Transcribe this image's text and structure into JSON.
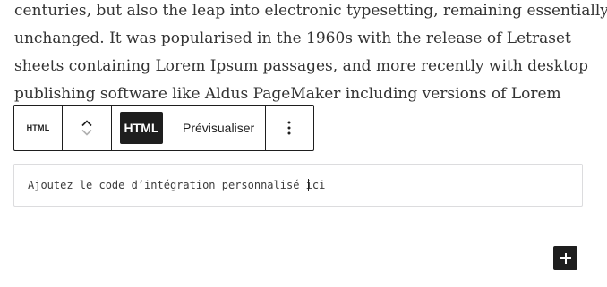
{
  "content": {
    "paragraph_lines": [
      "centuries, but also the leap into electronic typesetting, remaining essentially",
      "unchanged. It was popularised in the 1960s with the release of Letraset",
      "sheets containing Lorem Ipsum passages, and more recently with desktop",
      "publishing software like Aldus PageMaker including versions of Lorem"
    ]
  },
  "toolbar": {
    "block_type_label": "HTML",
    "block_type_icon": "html-block-icon",
    "move_up_icon": "chevron-up-icon",
    "move_down_icon": "chevron-down-icon",
    "mode_html_label": "HTML",
    "mode_preview_label": "Prévisualiser",
    "options_icon": "more-vertical-icon",
    "active_mode": "HTML"
  },
  "html_block": {
    "input_text_before_caret": "Ajoutez le code d’intégration personnalisé i",
    "input_text_after_caret": "ci"
  },
  "inserter": {
    "icon": "plus-icon"
  },
  "colors": {
    "toolbar_border": "#1e1e1e",
    "active_button_bg": "#1e1e1e",
    "input_border": "#dcdcde"
  }
}
